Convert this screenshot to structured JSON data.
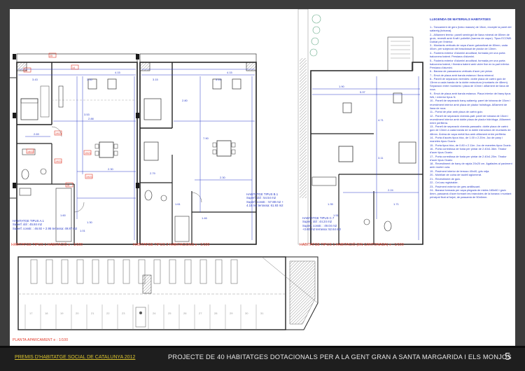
{
  "legend": {
    "title": "Llegenda de materials habitatges",
    "items": [
      "1.- Tancament de gero (totxo massís) de 15cm, excepte la paret del safareig (totxana).",
      "2.- Aïllament tèrmic: panell semirígid de llana mineral de 80mm de gruix, revestit amb Kraft i polietilè (barrera de vapor). Tipus ECOM0. Doblat per l'interior.",
      "3.- Muntants verticals de xapa d'acer galvanitzat de 80mm, cada 40cm, per subjecció del trasdossat de pladur de 13mm.",
      "4.- Fusteria exterior d'alumini anoditzat, formada per una porta balconera batent. Persiana d'alumini.",
      "5.- Fusteria exterior d'alumini anoditzat, formada per una porta balconera batent, i finestra batent amb vidre fixe en la part inferior. Persiana d'alumini.",
      "6.- Barana de passamans verticals d'acer per pintar.",
      "7.- Envà de placa amb banda estanca i llana mineral.",
      "8.- Panell de separació vivendes: doble placa de cartró guix de 13mm a cada banda de la doble estructura (muntants de 48mm). Separació entre muntants i placa de 10mm i aïllament de llana de roca.",
      "9.- Envà de placa amb banda estanca. Placa interior del bany tipus WA, i exterior tipus N.",
      "10.- Panell de separació bany-safareig: paret de totxana de 15cm i revestiment interior amb placa de pladur hidròfuga. Aïllament de llana de roca.",
      "11.- Portal de pilar amb placa de cartró guix.",
      "12.- Panell de separació vivenda-pati: paret de totxana de 15cm i revestiment interior amb doble placa de pladur hidròfuga. Aïllament entre perfileria.",
      "13.- Panell de separació vivenda-passadís: doble placa de cartró guix de 13mm a cada banda de la doble estructura de muntants de 48mm. Ànima de xapa metàl·lica amb aïllament entre perfileria.",
      "14.- Porta d'accés tipus bloc, de 1.00 x 2.20m. Joc de pany i manetes tipus Ocariz.",
      "15.- Porta tipus bloc, de 0.80 x 2.11m. Joc de manetes tipus Ocariz.",
      "16.- Porta corredissa de fusta per pintar de 2.40x1.36m. Tirador d'acer tipus Ocariz.",
      "17.- Porta corredissa de fusta per pintar de 2.40x1.20m. Tirador d'acer tipus Ocariz.",
      "18.- Revestiment de bany de rajola 20x20 cm. Agafades al paviment amb morter cola.",
      "19.- Paviment interior de terrazo 40x40, gris rotja.",
      "20.- Mobiliari de cuina de taulell aglomerat.",
      "21.- Revestiment de guix.",
      "22.- Cel-ras registrable.",
      "23.- Paviment exterior de gres antilliscant.",
      "24.- Barana formada per xapa plegada de mides 165x60 i gruix 6mm, passamà d'acer formant les bràndoles de la barana i muntant principal fixat al forjat, de passamà de 50x6mm."
    ]
  },
  "plans": [
    {
      "caption": "HABITATGE TIPUS 1 HABITACIÓ  e : 1/100",
      "area": {
        "name": "HABITATGE TIPUS A.1",
        "line1": "Superf. útil : 45.84 m2",
        "line2": "Superf. constr. : 46.92 + 2.95 terrassa: 49.87 m2"
      }
    },
    {
      "caption": "HABITATGE TIPUS 2 HABITACIONS  e : 1/100",
      "area": {
        "name": "HABITATGE TIPUS B.1",
        "line1": "Superf. útil : 54.54 m2",
        "line2": "Superf. constr. : 57.88 m2 +",
        "line3": "4.15 m2 terrassa: 61.93 m2"
      }
    },
    {
      "caption": "HABITATGE TIPUS 1 HABITACIÓ (EN CANTONADA)  e : 1/100",
      "area": {
        "name": "HABITATGE TIPUS C.7",
        "line1": "Superf. útil : 44.24 m2",
        "line2": "Superf. constr. : 49.04 m2",
        "line3": "+3.60 m2 terrassa: 52.64 m2"
      }
    }
  ],
  "parking": {
    "caption": "PLANTA APARCAMENT  e : 1/100"
  },
  "footer": {
    "prize": "PREMIS D'HABITATGE SOCIAL DE CATALUNYA 2012",
    "project": "PROJECTE DE 40 HABITATGES DOTACIONALS PER A LA GENT GRAN A SANTA MARGARIDA I ELS MONJOS",
    "page": "5"
  },
  "colors": {
    "sheet_background": "#3c3c3c",
    "paper": "#ffffff",
    "blue_annotation": "#2a3cc8",
    "red_annotation": "#e23a2a",
    "prize_text": "#d9c330",
    "footer_background": "#1e1e1e"
  }
}
